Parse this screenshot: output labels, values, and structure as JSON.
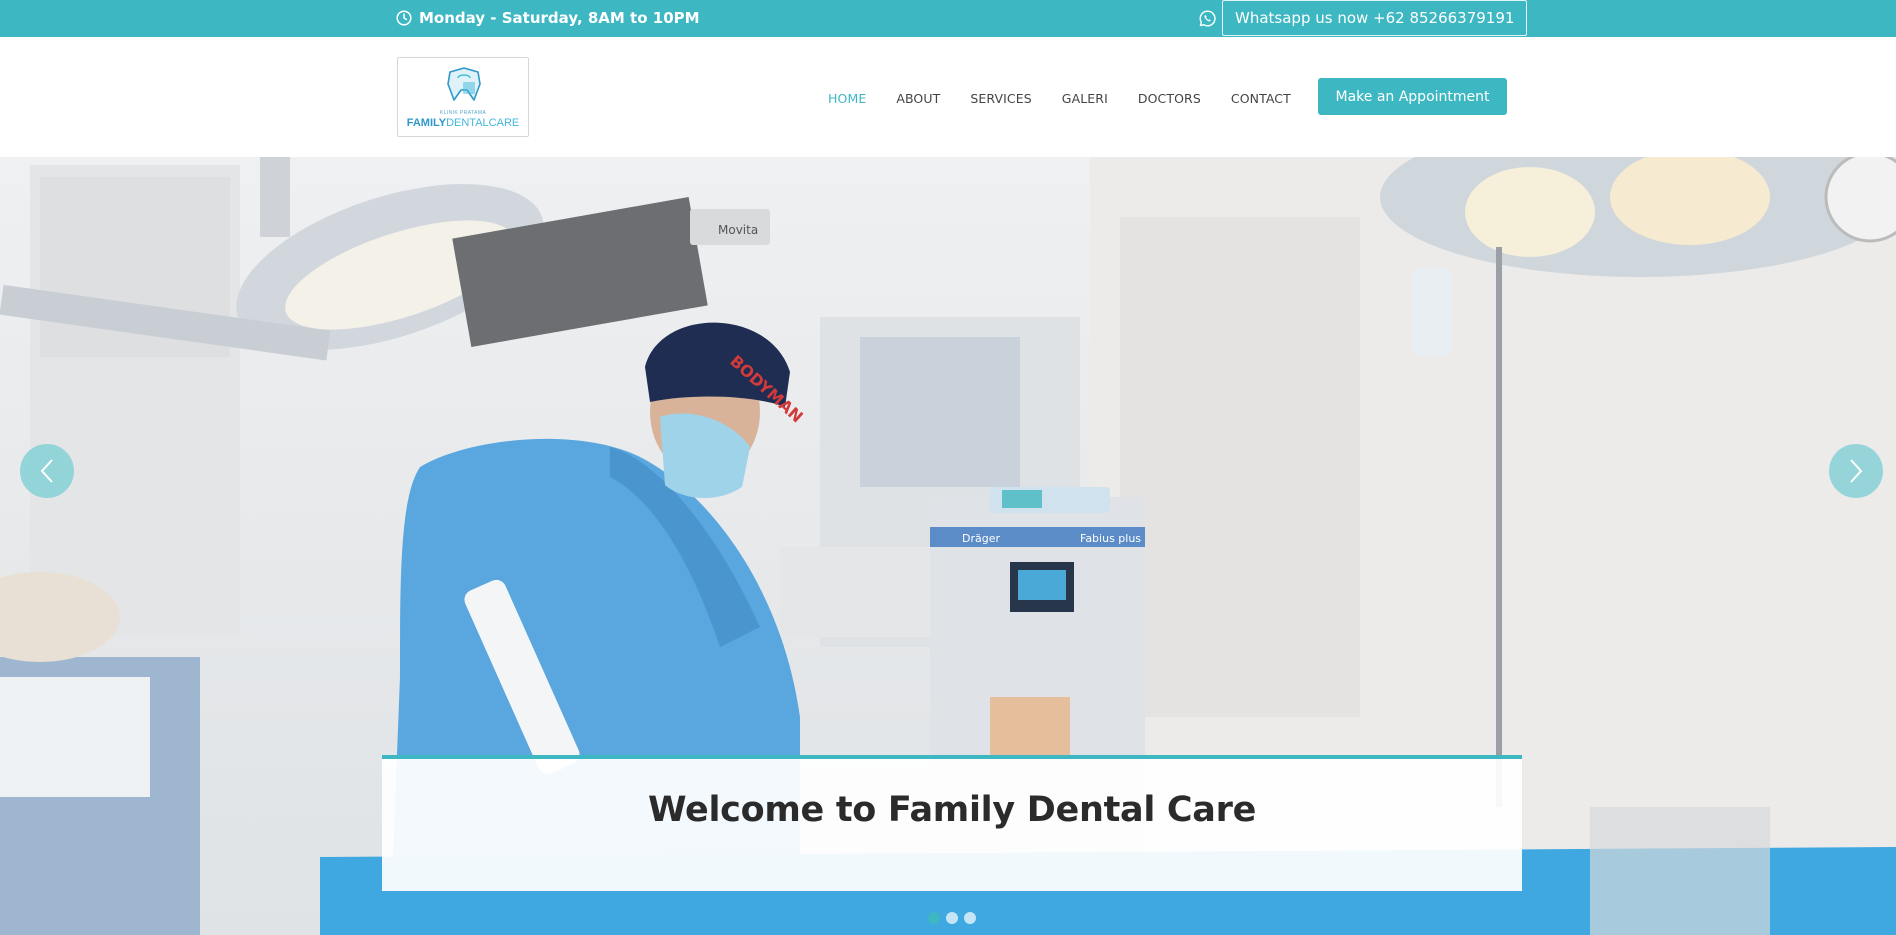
{
  "topbar": {
    "hours": "Monday - Saturday, 8AM to 10PM",
    "whatsapp": "Whatsapp us now +62 85266379191"
  },
  "logo": {
    "monogram": "FDC",
    "tagline": "KLINIK PRATAMA",
    "brand_bold": "FAMILY",
    "brand_light": "DENTALCARE"
  },
  "nav": {
    "items": [
      {
        "label": "HOME"
      },
      {
        "label": "ABOUT"
      },
      {
        "label": "SERVICES"
      },
      {
        "label": "GALERI"
      },
      {
        "label": "DOCTORS"
      },
      {
        "label": "CONTACT"
      }
    ],
    "cta": "Make an Appointment"
  },
  "hero": {
    "caption": "Welcome to Family Dental Care",
    "slide_count": 3,
    "active_slide": 1,
    "equipment_text": {
      "light_brand": "Movita",
      "machine_left": "Dräger",
      "machine_right": "Fabius plus",
      "cap_text": "BODYMAN"
    }
  },
  "colors": {
    "accent": "#3db8c2",
    "nav_text": "#444444",
    "caption_text": "#2b2b2b"
  }
}
